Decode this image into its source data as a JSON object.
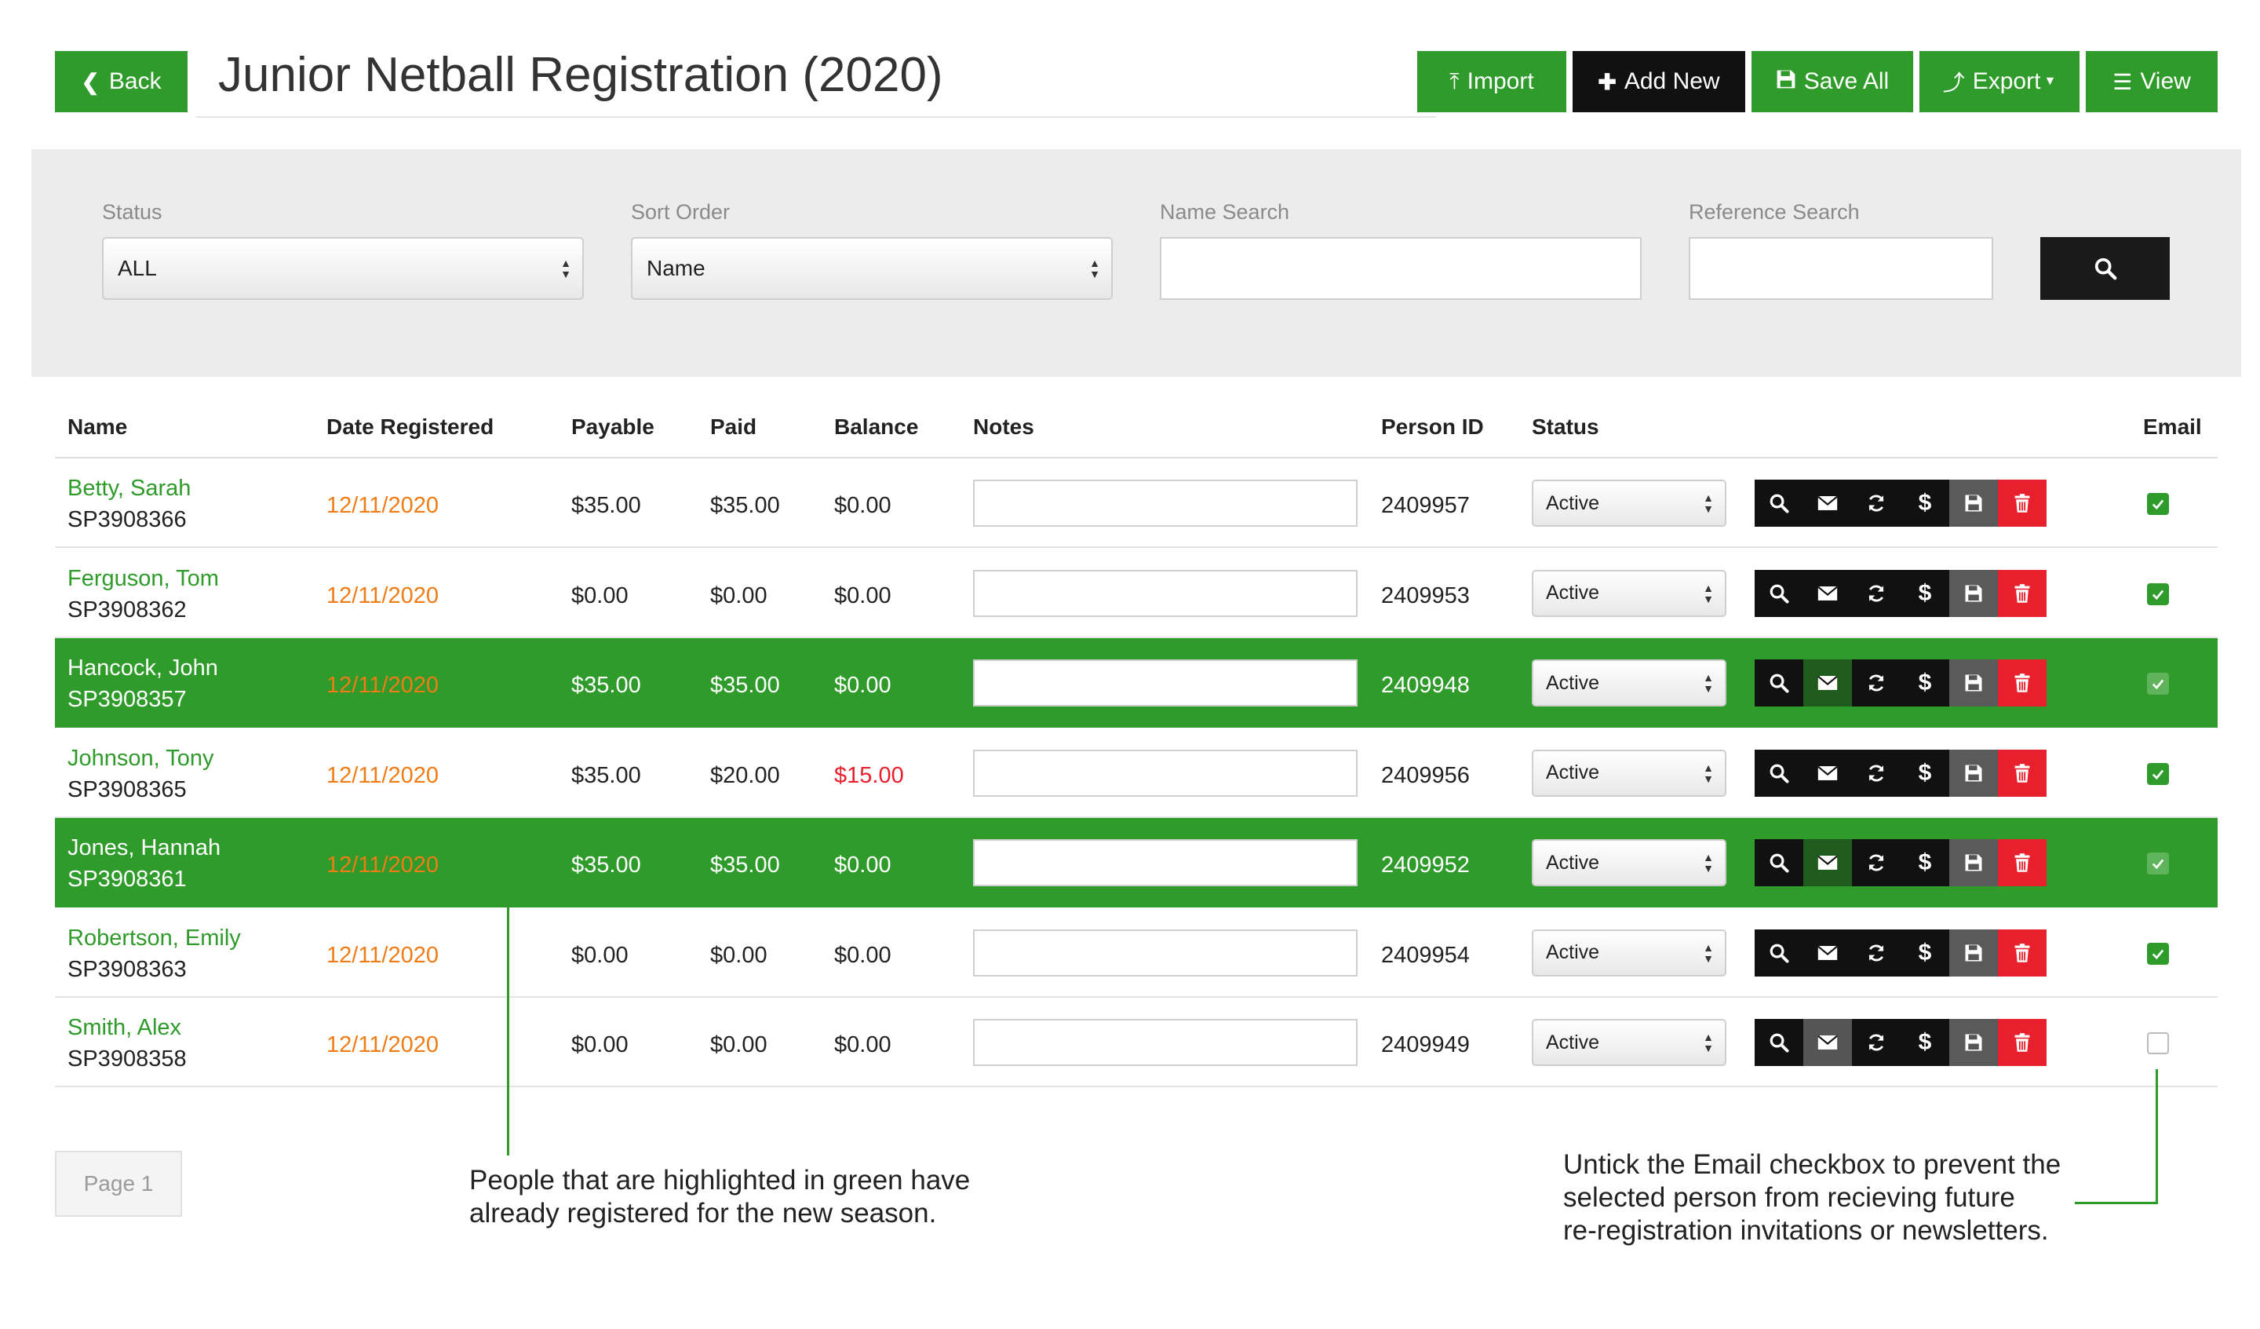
{
  "header": {
    "back_label": "Back",
    "title": "Junior Netball Registration (2020)",
    "import_label": "Import",
    "add_new_label": "Add New",
    "save_all_label": "Save All",
    "export_label": "Export",
    "view_label": "View"
  },
  "filters": {
    "status_label": "Status",
    "status_value": "ALL",
    "sort_label": "Sort Order",
    "sort_value": "Name",
    "name_search_label": "Name Search",
    "reference_search_label": "Reference Search"
  },
  "table": {
    "columns": {
      "name": "Name",
      "date": "Date Registered",
      "payable": "Payable",
      "paid": "Paid",
      "balance": "Balance",
      "notes": "Notes",
      "person_id": "Person ID",
      "status": "Status",
      "email": "Email"
    },
    "rows": [
      {
        "name": "Betty, Sarah",
        "ref": "SP3908366",
        "date": "12/11/2020",
        "payable": "$35.00",
        "paid": "$35.00",
        "balance": "$0.00",
        "person_id": "2409957",
        "status": "Active",
        "email": true,
        "highlighted": false
      },
      {
        "name": "Ferguson, Tom",
        "ref": "SP3908362",
        "date": "12/11/2020",
        "payable": "$0.00",
        "paid": "$0.00",
        "balance": "$0.00",
        "person_id": "2409953",
        "status": "Active",
        "email": true,
        "highlighted": false
      },
      {
        "name": "Hancock, John",
        "ref": "SP3908357",
        "date": "12/11/2020",
        "payable": "$35.00",
        "paid": "$35.00",
        "balance": "$0.00",
        "person_id": "2409948",
        "status": "Active",
        "email": true,
        "highlighted": true
      },
      {
        "name": "Johnson, Tony",
        "ref": "SP3908365",
        "date": "12/11/2020",
        "payable": "$35.00",
        "paid": "$20.00",
        "balance": "$15.00",
        "person_id": "2409956",
        "status": "Active",
        "email": true,
        "highlighted": false
      },
      {
        "name": "Jones, Hannah",
        "ref": "SP3908361",
        "date": "12/11/2020",
        "payable": "$35.00",
        "paid": "$35.00",
        "balance": "$0.00",
        "person_id": "2409952",
        "status": "Active",
        "email": true,
        "highlighted": true
      },
      {
        "name": "Robertson, Emily",
        "ref": "SP3908363",
        "date": "12/11/2020",
        "payable": "$0.00",
        "paid": "$0.00",
        "balance": "$0.00",
        "person_id": "2409954",
        "status": "Active",
        "email": true,
        "highlighted": false
      },
      {
        "name": "Smith, Alex",
        "ref": "SP3908358",
        "date": "12/11/2020",
        "payable": "$0.00",
        "paid": "$0.00",
        "balance": "$0.00",
        "person_id": "2409949",
        "status": "Active",
        "email": false,
        "highlighted": false
      }
    ]
  },
  "pager": {
    "label": "Page 1"
  },
  "annotations": {
    "green_line1": "People that are highlighted in green have",
    "green_line2": "already registered for the new season.",
    "email_line1": "Untick the Email checkbox to prevent the",
    "email_line2": "selected person from recieving future",
    "email_line3": "re-registration invitations or newsletters."
  },
  "colors": {
    "brand_green": "#2e9b2a",
    "date_orange": "#f07c16",
    "danger_red": "#e8202e"
  }
}
